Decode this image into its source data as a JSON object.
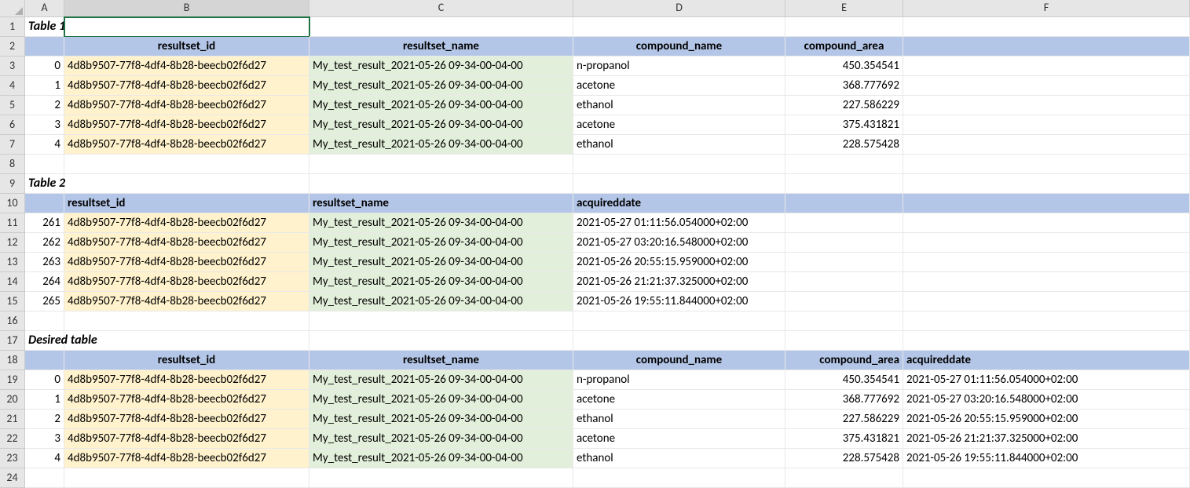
{
  "columns": [
    "A",
    "B",
    "C",
    "D",
    "E",
    "F"
  ],
  "row_numbers": [
    1,
    2,
    3,
    4,
    5,
    6,
    7,
    8,
    9,
    10,
    11,
    12,
    13,
    14,
    15,
    16,
    17,
    18,
    19,
    20,
    21,
    22,
    23,
    24
  ],
  "active_col": "B",
  "titles": {
    "t1": "Table 1",
    "t2": "Table 2",
    "t3": "Desired table"
  },
  "headers": {
    "resultset_id": "resultset_id",
    "resultset_name": "resultset_name",
    "compound_name": "compound_name",
    "compound_area": "compound_area",
    "acquireddate": "acquireddate"
  },
  "guid": "4d8b9507-77f8-4df4-8b28-beecb02f6d27",
  "resultset_name": "My_test_result_2021-05-26 09-34-00-04-00",
  "table1": [
    {
      "idx": "0",
      "compound": "n-propanol",
      "area": "450.354541"
    },
    {
      "idx": "1",
      "compound": "acetone",
      "area": "368.777692"
    },
    {
      "idx": "2",
      "compound": "ethanol",
      "area": "227.586229"
    },
    {
      "idx": "3",
      "compound": "acetone",
      "area": "375.431821"
    },
    {
      "idx": "4",
      "compound": "ethanol",
      "area": "228.575428"
    }
  ],
  "table2": [
    {
      "idx": "261",
      "acq": "2021-05-27 01:11:56.054000+02:00"
    },
    {
      "idx": "262",
      "acq": "2021-05-27 03:20:16.548000+02:00"
    },
    {
      "idx": "263",
      "acq": "2021-05-26 20:55:15.959000+02:00"
    },
    {
      "idx": "264",
      "acq": "2021-05-26 21:21:37.325000+02:00"
    },
    {
      "idx": "265",
      "acq": "2021-05-26 19:55:11.844000+02:00"
    }
  ],
  "table3": [
    {
      "idx": "0",
      "compound": "n-propanol",
      "area": "450.354541",
      "acq": "2021-05-27 01:11:56.054000+02:00"
    },
    {
      "idx": "1",
      "compound": "acetone",
      "area": "368.777692",
      "acq": "2021-05-27 03:20:16.548000+02:00"
    },
    {
      "idx": "2",
      "compound": "ethanol",
      "area": "227.586229",
      "acq": "2021-05-26 20:55:15.959000+02:00"
    },
    {
      "idx": "3",
      "compound": "acetone",
      "area": "375.431821",
      "acq": "2021-05-26 21:21:37.325000+02:00"
    },
    {
      "idx": "4",
      "compound": "ethanol",
      "area": "228.575428",
      "acq": "2021-05-26 19:55:11.844000+02:00"
    }
  ]
}
